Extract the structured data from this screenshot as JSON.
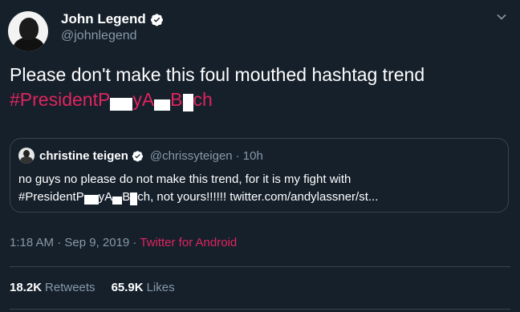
{
  "author": {
    "name": "John Legend",
    "handle": "@johnlegend"
  },
  "tweet": {
    "text": "Please don't make this foul mouthed hashtag trend",
    "hashtag_parts": [
      "#PresidentP",
      "yA",
      "B",
      "ch"
    ]
  },
  "quoted": {
    "name": "christine teigen",
    "handle": "@chrissyteigen",
    "time": "· 10h",
    "line1": "no guys no please do not make this trend, for it is my fight with",
    "line2_parts": [
      "#PresidentP",
      "yA",
      "B",
      "ch, not yours!!!!!! twitter.com/andylassner/st..."
    ]
  },
  "meta": {
    "time": "1:18 AM · Sep 9, 2019 ·",
    "source": "Twitter for Android"
  },
  "stats": {
    "retweets_count": "18.2K",
    "retweets_label": "Retweets",
    "likes_count": "65.9K",
    "likes_label": "Likes"
  },
  "colors": {
    "background": "#15202b",
    "hashtag": "#e0245e",
    "secondary": "#8899a6",
    "verified": "#ffffff"
  },
  "icons": [
    "verified-badge-icon",
    "chevron-down-icon"
  ]
}
